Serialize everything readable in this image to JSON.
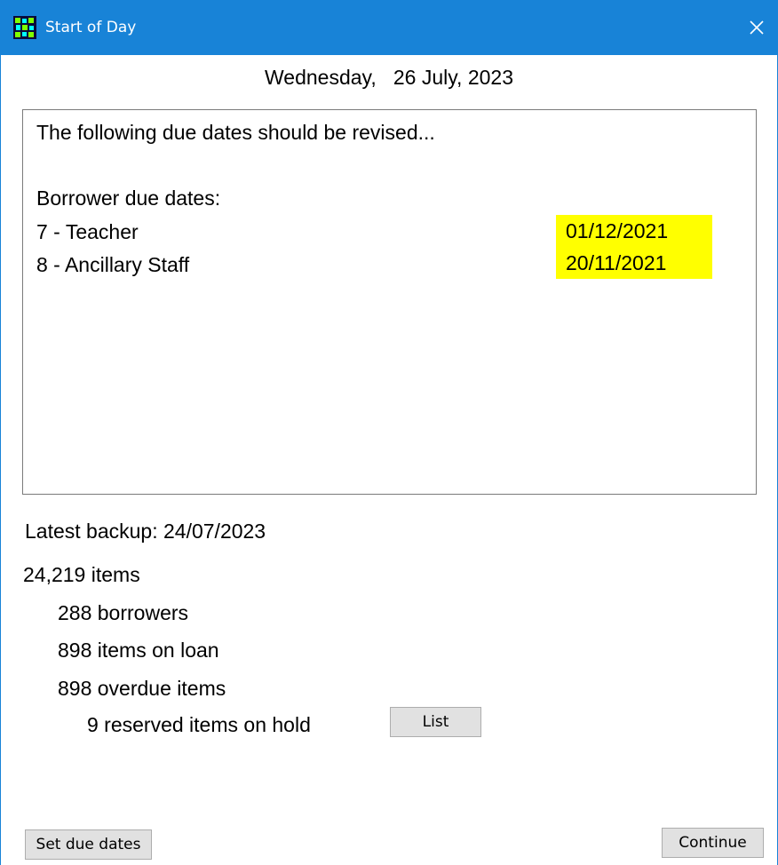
{
  "window": {
    "title": "Start of Day"
  },
  "date_line": "Wednesday,   26 July, 2023",
  "message": {
    "intro": "The following due dates should be revised...",
    "section_label": "Borrower due dates:",
    "rows": [
      {
        "borrower": "7 - Teacher",
        "due_date": "01/12/2021"
      },
      {
        "borrower": "8 - Ancillary Staff",
        "due_date": "20/11/2021"
      }
    ],
    "highlight_color": "#ffff00"
  },
  "backup": "Latest backup: 24/07/2023",
  "stats": {
    "items": "24,219 items",
    "borrowers": "288 borrowers",
    "on_loan": "898 items on loan",
    "overdue": "898 overdue items",
    "reserved": "9 reserved items on hold"
  },
  "buttons": {
    "list": "List",
    "set_due_dates": "Set due dates",
    "continue": "Continue"
  },
  "colors": {
    "titlebar": "#1883d7"
  }
}
